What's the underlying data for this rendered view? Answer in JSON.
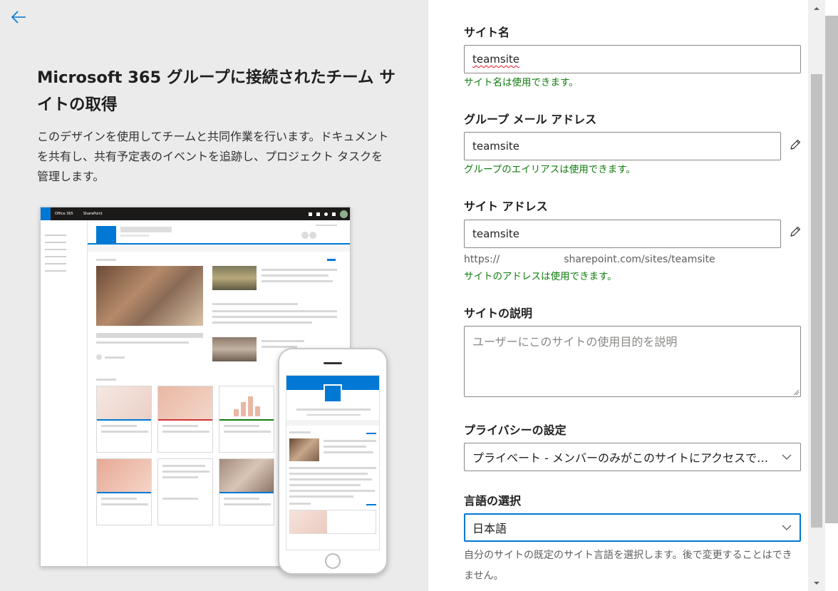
{
  "left": {
    "title": "Microsoft 365 グループに接続されたチーム サイトの取得",
    "description": "このデザインを使用してチームと共同作業を行います。ドキュメントを共有し、共有予定表のイベントを追跡し、プロジェクト タスクを管理します。",
    "preview": {
      "app_name": "Office 365",
      "product_name": "SharePoint"
    }
  },
  "form": {
    "site_name": {
      "label": "サイト名",
      "value": "teamsite",
      "status": "サイト名は使用できます。"
    },
    "group_email": {
      "label": "グループ メール アドレス",
      "value": "teamsite",
      "status": "グループのエイリアスは使用できます。"
    },
    "site_address": {
      "label": "サイト アドレス",
      "value": "teamsite",
      "url_prefix": "https://",
      "url_suffix": "sharepoint.com/sites/teamsite",
      "status": "サイトのアドレスは使用できます。"
    },
    "description": {
      "label": "サイトの説明",
      "placeholder": "ユーザーにこのサイトの使用目的を説明"
    },
    "privacy": {
      "label": "プライバシーの設定",
      "selected": "プライベート - メンバーのみがこのサイトにアクセスできます"
    },
    "language": {
      "label": "言語の選択",
      "selected": "日本語",
      "help": "自分のサイトの既定のサイト言語を選択します。後で変更することはできません。"
    }
  },
  "colors": {
    "accent": "#0078d4",
    "success": "#107c10",
    "left_bg": "#ebebeb"
  },
  "icons": {
    "back": "arrow-left-icon",
    "edit": "pencil-icon",
    "chevron": "chevron-down-icon"
  }
}
